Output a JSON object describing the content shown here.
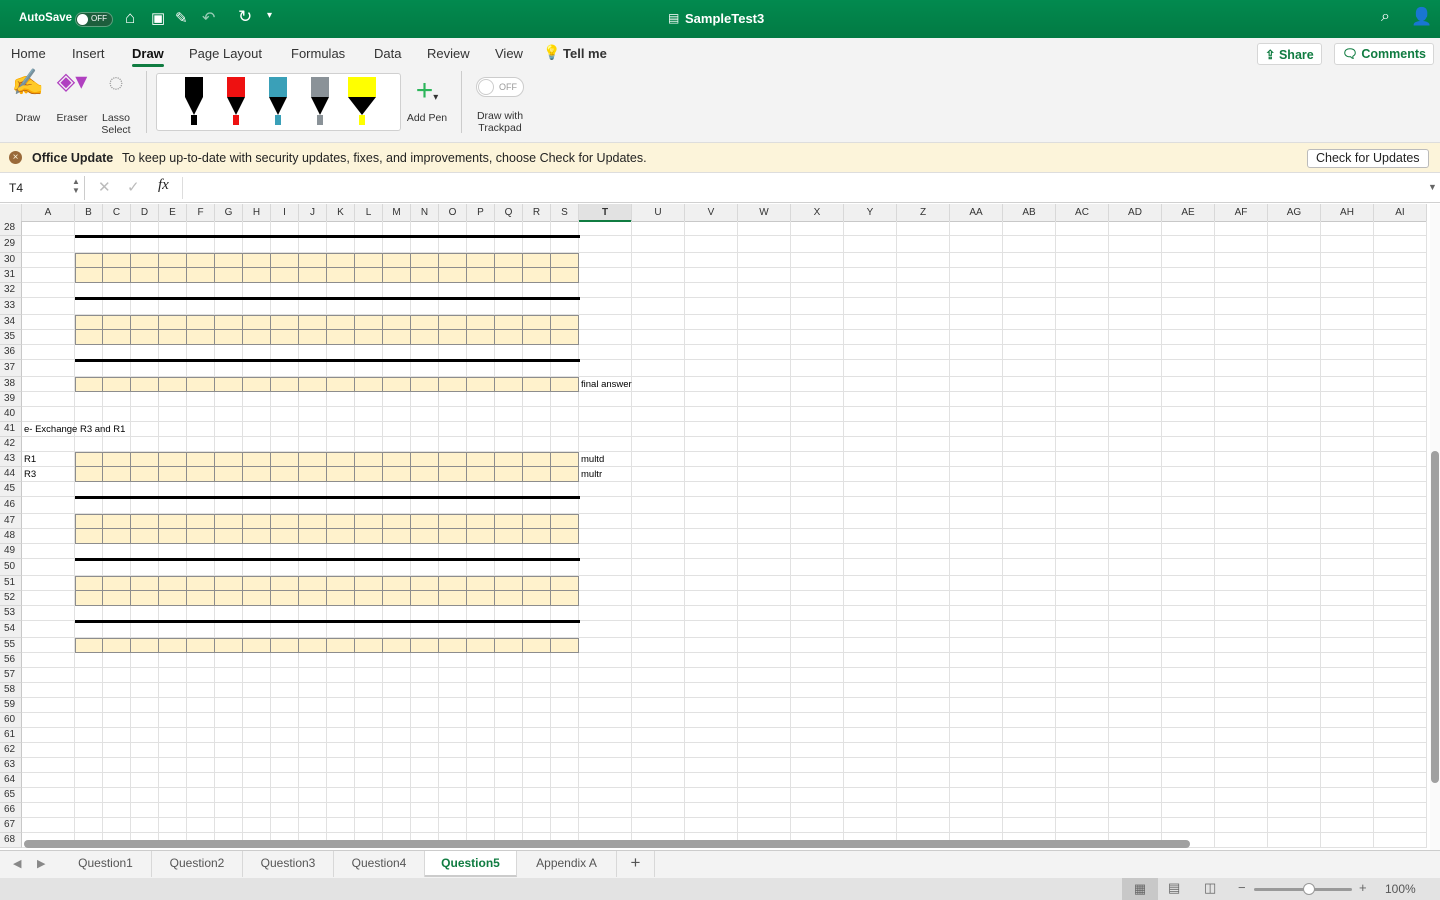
{
  "titlebar": {
    "autosave_label": "AutoSave",
    "autosave_state": "OFF",
    "doc_title": "SampleTest3",
    "accent": "#107c41"
  },
  "ribbon": {
    "tabs": [
      "Home",
      "Insert",
      "Draw",
      "Page Layout",
      "Formulas",
      "Data",
      "Review",
      "View"
    ],
    "active_tab": "Draw",
    "tell_me": "Tell me",
    "share": "Share",
    "comments": "Comments",
    "tools": {
      "draw": "Draw",
      "eraser": "Eraser",
      "lasso_1": "Lasso",
      "lasso_2": "Select",
      "add_pen": "Add Pen",
      "trackpad_1": "Draw with",
      "trackpad_2": "Trackpad",
      "trackpad_state": "OFF"
    },
    "pens": [
      {
        "color": "#000000"
      },
      {
        "color": "#ee1111"
      },
      {
        "color": "#3aa0b8"
      },
      {
        "color": "#8a9298"
      },
      {
        "color": "#ffff00"
      }
    ]
  },
  "update_bar": {
    "title": "Office Update",
    "message": "To keep up-to-date with security updates, fixes, and improvements, choose Check for Updates.",
    "button": "Check for Updates"
  },
  "formula_bar": {
    "name_box": "T4",
    "fx": "fx",
    "value": ""
  },
  "grid": {
    "columns": [
      "A",
      "B",
      "C",
      "D",
      "E",
      "F",
      "G",
      "H",
      "I",
      "J",
      "K",
      "L",
      "M",
      "N",
      "O",
      "P",
      "Q",
      "R",
      "S",
      "T",
      "U",
      "V",
      "W",
      "X",
      "Y",
      "Z",
      "AA",
      "AB",
      "AC",
      "AD",
      "AE",
      "AF",
      "AG",
      "AH",
      "AI"
    ],
    "selected_column": "T",
    "first_row": 28,
    "last_row": 68,
    "highlight_rows": [
      30,
      31,
      34,
      35,
      38,
      43,
      44,
      47,
      48,
      51,
      52,
      55
    ],
    "thick_border_above_rows": [
      29,
      33,
      37,
      46,
      50,
      54
    ],
    "highlight_color": "#fff2cc",
    "cells": [
      {
        "ref": "T38",
        "col": "T",
        "row": 38,
        "value": "final answer"
      },
      {
        "ref": "A41",
        "col": "A",
        "row": 41,
        "value": "e- Exchange R3 and R1"
      },
      {
        "ref": "A43",
        "col": "A",
        "row": 43,
        "value": "R1"
      },
      {
        "ref": "T43",
        "col": "T",
        "row": 43,
        "value": "multd"
      },
      {
        "ref": "A44",
        "col": "A",
        "row": 44,
        "value": "R3"
      },
      {
        "ref": "T44",
        "col": "T",
        "row": 44,
        "value": "multr"
      }
    ]
  },
  "sheets": {
    "tabs": [
      "Question1",
      "Question2",
      "Question3",
      "Question4",
      "Question5",
      "Appendix A"
    ],
    "active": "Question5",
    "add": "+"
  },
  "status": {
    "zoom": "100%",
    "zoom_percent": 100
  }
}
